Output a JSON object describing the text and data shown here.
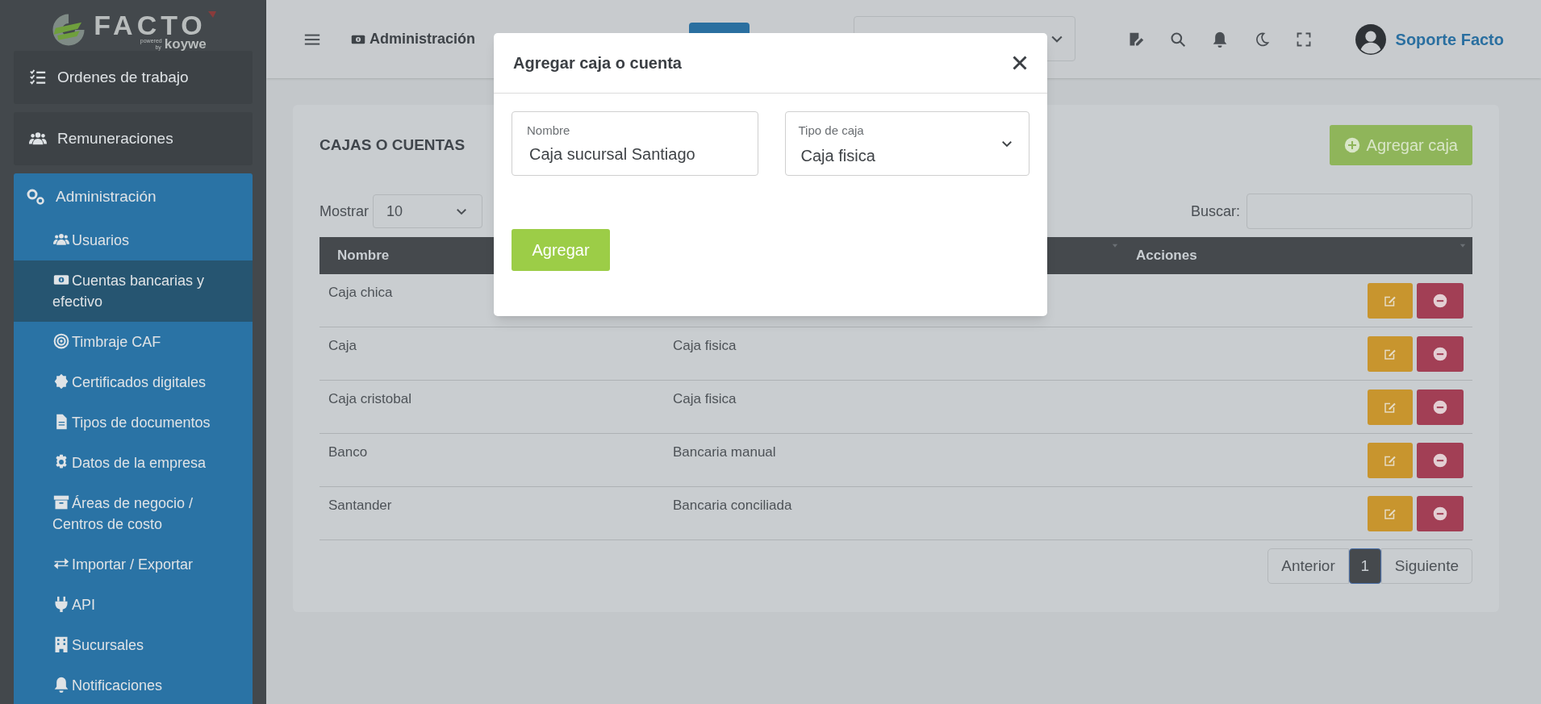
{
  "logo": {
    "name": "FACTO",
    "tagline_small": "powered by",
    "tagline_brand": "koywe"
  },
  "topbar": {
    "breadcrumb": "Administración",
    "user": "Soporte Facto"
  },
  "sidebar": {
    "items": [
      {
        "label": "Ordenes de trabajo",
        "selected": false
      },
      {
        "label": "Remuneraciones",
        "selected": false
      },
      {
        "label": "Administración",
        "selected": true,
        "expanded": true,
        "children": [
          {
            "label": "Usuarios",
            "selected": false
          },
          {
            "label": "Cuentas bancarias y efectivo",
            "selected": true
          },
          {
            "label": "Timbraje CAF",
            "selected": false
          },
          {
            "label": "Certificados digitales",
            "selected": false
          },
          {
            "label": "Tipos de documentos",
            "selected": false
          },
          {
            "label": "Datos de la empresa",
            "selected": false
          },
          {
            "label": "Áreas de negocio / Centros de costo",
            "selected": false
          },
          {
            "label": "Importar / Exportar",
            "selected": false
          },
          {
            "label": "API",
            "selected": false
          },
          {
            "label": "Sucursales",
            "selected": false
          },
          {
            "label": "Notificaciones",
            "selected": false
          }
        ]
      }
    ]
  },
  "card": {
    "title": "CAJAS O CUENTAS",
    "add_button": "Agregar caja",
    "show_label": "Mostrar",
    "show_value": "10",
    "search_label": "Buscar:"
  },
  "table": {
    "columns": [
      "Nombre",
      "Acciones"
    ],
    "rows": [
      {
        "name": "Caja chica"
      },
      {
        "name": "Caja",
        "type": "Caja fisica"
      },
      {
        "name": "Caja cristobal",
        "type": "Caja fisica"
      },
      {
        "name": "Banco",
        "type": "Bancaria manual"
      },
      {
        "name": "Santander",
        "type": "Bancaria conciliada"
      }
    ]
  },
  "pagination": {
    "previous": "Anterior",
    "pages": [
      {
        "label": "1",
        "selected": true
      }
    ],
    "next": "Siguiente"
  },
  "modal": {
    "title": "Agregar caja o cuenta",
    "name_label": "Nombre",
    "name_value": "Caja sucursal Santiago",
    "type_label": "Tipo de caja",
    "type_value": "Caja fisica",
    "submit": "Agregar"
  }
}
